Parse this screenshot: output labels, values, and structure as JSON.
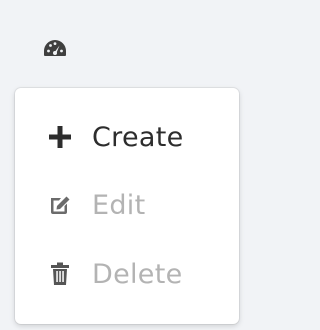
{
  "toolbar": {
    "icon": "dashboard-gauge-icon"
  },
  "menu": {
    "items": [
      {
        "label": "Create",
        "icon": "plus-icon",
        "enabled": true,
        "color": "#2d2d2d"
      },
      {
        "label": "Edit",
        "icon": "edit-icon",
        "enabled": false,
        "color": "#b3b3b3"
      },
      {
        "label": "Delete",
        "icon": "trash-icon",
        "enabled": false,
        "color": "#b3b3b3"
      }
    ]
  }
}
